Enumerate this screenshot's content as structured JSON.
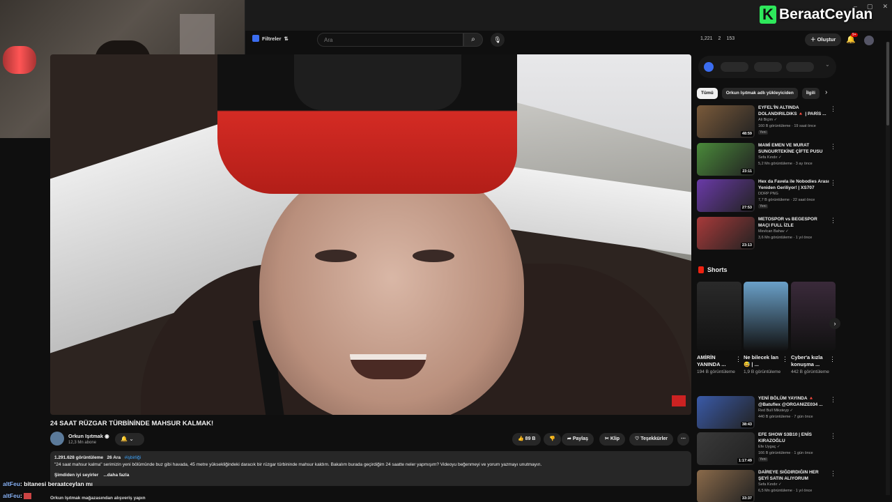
{
  "brand": {
    "logo_letter": "K",
    "name": "BeraatCeylan",
    "logo_color": "#2ee85b"
  },
  "window_controls": {
    "minimize": "–",
    "restore": "▢",
    "close": "✕"
  },
  "header": {
    "filters_label": "Filtreler",
    "search_placeholder": "Ara",
    "stats": [
      "1,221",
      "2",
      "153"
    ],
    "create_label": "Oluştur",
    "notifications_badge": "9+"
  },
  "video": {
    "title": "24 SAAT RÜZGAR TÜRBİNİNDE MAHSUR KALMAK!",
    "channel": "Orkun Işıtmak",
    "subscribers": "12,3 Mn abone",
    "likes": "89 B",
    "share_label": "Paylaş",
    "clip_label": "Klip",
    "thanks_label": "Teşekkürler",
    "views": "1.291.628 görüntüleme",
    "date": "26 Ara",
    "hashtag": "#işbirliği",
    "description": "\"24 saat mahsur kalma\" serimizin yeni bölümünde buz gibi havada, 45 metre yüksekliğindeki daracık bir rüzgar türbininde mahsur kaldım. Bakalım burada geçirdiğim 24 saatte neler yapmışım? Videoyu beğenmeyi ve yorum yazmayı unutmayın.",
    "description_trail": "Şimdiden iyi seyirler",
    "more_label": "...daha fazla",
    "shop_text": "Orkun Işıtmak mağazasından alışveriş yapın"
  },
  "chat": [
    {
      "user": "altFeu",
      "message": ": bitanesi beraatceylan mı"
    },
    {
      "user": "altFeu",
      "message": ":"
    }
  ],
  "sidebar": {
    "chips": [
      {
        "label": "Tümü",
        "active": true
      },
      {
        "label": "Orkun Işıtmak adlı yükleyiciden",
        "active": false
      },
      {
        "label": "İlgili",
        "active": false
      }
    ],
    "videos": [
      {
        "title": "EYFEL'İN ALTINDA DOLANDIRILDIKS 🔺 | PARİS ...",
        "channel": "Ali Biçim ✓",
        "views": "160 B görüntüleme · 19 saat önce",
        "badge": "Yeni",
        "duration": "48:59",
        "color": "#7a5a3a"
      },
      {
        "title": "MAMİ EMEN VE MURAT SUNGURTEKİNE ÇİFTE PUSU",
        "channel": "Sefa Kındır ✓",
        "views": "5,2 Mn görüntüleme · 3 ay önce",
        "badge": "",
        "duration": "23:11",
        "color": "#4a8a3a"
      },
      {
        "title": "Hex da Favela ile Nobodies Arası Yeniden Geriliyor! | XS707",
        "channel": "DDRP PNG",
        "views": "7,7 B görüntüleme · 22 saat önce",
        "badge": "Yeni",
        "duration": "27:53",
        "color": "#6a3aa8"
      },
      {
        "title": "METOSPOR vs BEGESPOR MAÇI FULL İZLE",
        "channel": "Mevlcan Bahav ✓",
        "views": "3,6 Mn görüntüleme · 1 yıl önce",
        "badge": "",
        "duration": "23:13",
        "color": "#a83a3a"
      },
      {
        "title": "YENİ BÖLÜM YAYINDA 🔺 @Batuflex @ORGANIZE034 ...",
        "channel": "Red Bull Miksteyp ✓",
        "views": "440 B görüntüleme · 7 gün önce",
        "badge": "",
        "duration": "38:43",
        "color": "#3a5aa8"
      },
      {
        "title": "EFE SHOW S3B10 | ENİS KIRAZOĞLU",
        "channel": "Efe Uygaç ✓",
        "views": "166 B görüntüleme · 1 gün önce",
        "badge": "Yeni",
        "duration": "1:17:49",
        "color": "#3a3a3a"
      },
      {
        "title": "DAİREYE SIĞDIRDIĞIN HER ŞEYİ SATIN ALIYORUM",
        "channel": "Sefa Kındır ✓",
        "views": "6,5 Mn görüntüleme · 1 yıl önce",
        "badge": "",
        "duration": "33:37",
        "color": "#8a6a4a"
      }
    ],
    "shorts_label": "Shorts",
    "shorts": [
      {
        "title": "AMİRİN YANINDA ...",
        "views": "194 B görüntüleme",
        "color": "#2a2a2a"
      },
      {
        "title": "Ne bilecek lan 😅 | ...",
        "views": "1,9 B görüntüleme",
        "color": "#6aa0c8"
      },
      {
        "title": "Cyber'a kızla konuşma ...",
        "views": "442 B görüntüleme",
        "color": "#3a2a3a"
      }
    ]
  }
}
